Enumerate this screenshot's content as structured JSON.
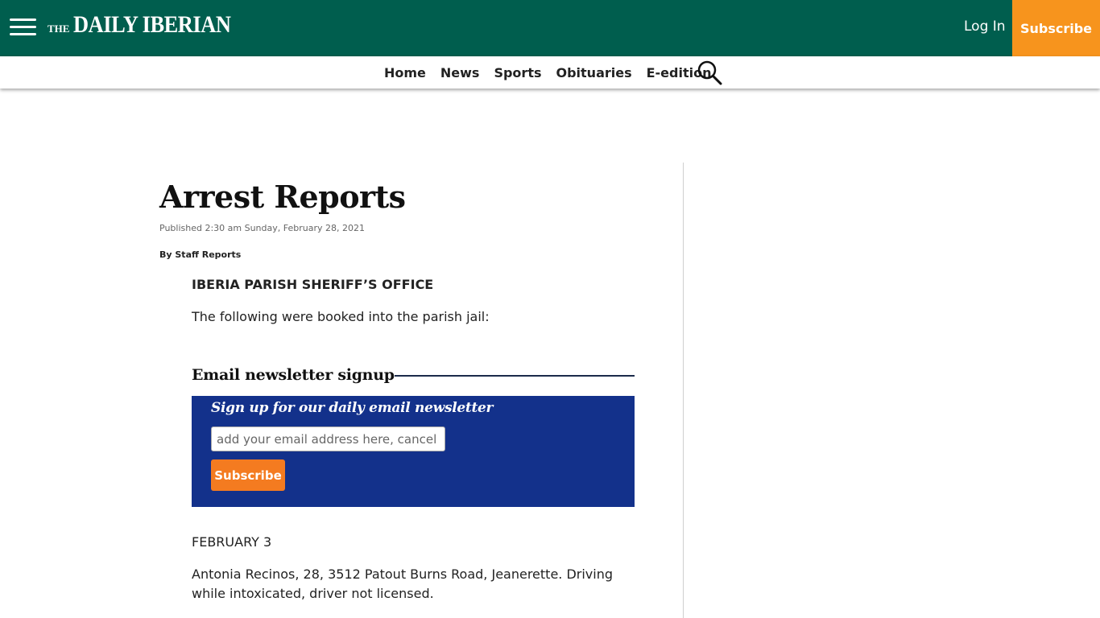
{
  "header": {
    "logo_the": "THE",
    "logo_main": "DAILY IBERIAN",
    "login_label": "Log In",
    "subscribe_label": "Subscribe",
    "bg_color": "#005e4e",
    "subscribe_color": "#f7941d"
  },
  "nav": {
    "items": [
      "Home",
      "News",
      "Sports",
      "Obituaries",
      "E-edition"
    ],
    "search_icon": "search-icon"
  },
  "article": {
    "headline": "Arrest Reports",
    "published": "Published 2:30 am Sunday, February 28, 2021",
    "byline": "By Staff Reports",
    "section_heading": "IBERIA PARISH SHERIFF’S OFFICE",
    "intro": "The following were booked into the parish jail:",
    "date_heading": "FEBRUARY 3",
    "entry_1": "Antonia Recinos, 28, 3512 Patout Burns Road, Jeanerette. Driving while intoxicated, driver not licensed."
  },
  "newsletter": {
    "heading": "Email newsletter signup",
    "title": "Sign up for our daily email newsletter",
    "placeholder": "add your email address here, cancel anytime",
    "button_label": "Subscribe",
    "box_color": "#13318b",
    "button_color": "#f47b20"
  }
}
